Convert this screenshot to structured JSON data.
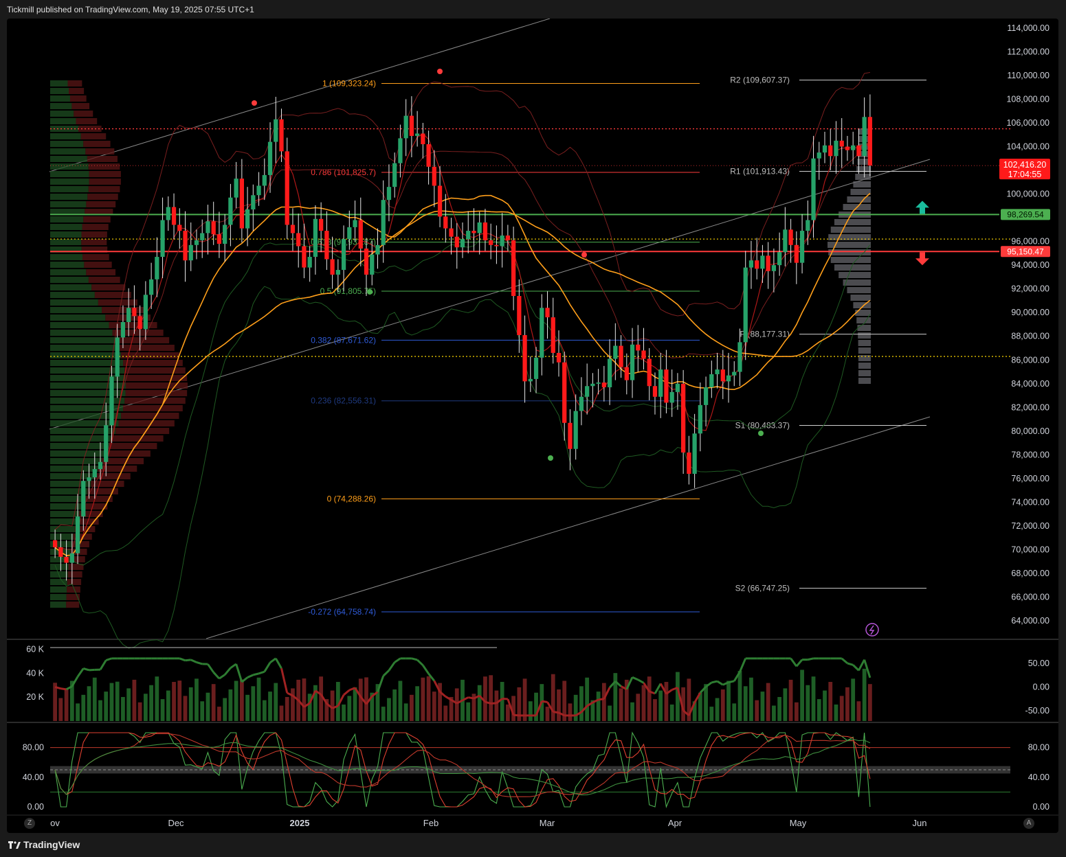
{
  "header": {
    "published": "Tickmill published on TradingView.com, May 19, 2025 07:55 UTC+1"
  },
  "footer": {
    "brand": "TradingView",
    "left_button": "Z",
    "right_button": "A"
  },
  "colors": {
    "up": "#26a269",
    "down": "#ff1a1a",
    "ma_orange": "#ff9f1a",
    "green_level": "#4caf50",
    "red_level": "#ff3b3b",
    "fib_orange": "#ff9f1a",
    "fib_blue": "#2f5bd8"
  },
  "chart_data": [
    {
      "type": "candlestick",
      "symbol_price_label": "102,416.20",
      "countdown": "17:04:55",
      "y_axis_ticks": [
        "114,000.00",
        "112,000.00",
        "110,000.00",
        "108,000.00",
        "106,000.00",
        "104,000.00",
        "100,000.00",
        "96,000.00",
        "94,000.00",
        "92,000.00",
        "90,000.00",
        "88,000.00",
        "86,000.00",
        "84,000.00",
        "82,000.00",
        "80,000.00",
        "78,000.00",
        "76,000.00",
        "74,000.00",
        "72,000.00",
        "70,000.00",
        "68,000.00",
        "66,000.00",
        "64,000.00"
      ],
      "y_axis_tick_values": [
        114000,
        112000,
        110000,
        108000,
        106000,
        104000,
        100000,
        96000,
        94000,
        92000,
        90000,
        88000,
        86000,
        84000,
        82000,
        80000,
        78000,
        76000,
        74000,
        72000,
        70000,
        68000,
        66000,
        64000
      ],
      "ylim": [
        62500,
        114800
      ],
      "x_axis_labels": [
        "ov",
        "Dec",
        "2025",
        "Feb",
        "Mar",
        "Apr",
        "May",
        "Jun"
      ],
      "price_badges": [
        {
          "label": "98,269.54",
          "value": 98269.54,
          "color": "#4caf50"
        },
        {
          "label": "95,150.47",
          "value": 95150.47,
          "color": "#ff3b3b"
        }
      ],
      "fib_levels": [
        {
          "label": "1 (109,323.24)",
          "value": 109323.24,
          "color": "#ff9f1a"
        },
        {
          "label": "0.786 (101,825.7)",
          "value": 101825.7,
          "color": "#ff3b3b"
        },
        {
          "label": "0.618 (95,937.87)",
          "value": 95937.87,
          "color": "#4caf50"
        },
        {
          "label": "0.5 (91,805.75)",
          "value": 91805.75,
          "color": "#4caf50"
        },
        {
          "label": "0.382 (87,671.62)",
          "value": 87671.62,
          "color": "#2f5bd8"
        },
        {
          "label": "0.236 (82,556.31)",
          "value": 82556.31,
          "color": "#1f3a80"
        },
        {
          "label": "0 (74,288.26)",
          "value": 74288.26,
          "color": "#ff9f1a"
        },
        {
          "label": "-0.272 (64,758.74)",
          "value": 64758.74,
          "color": "#2f5bd8"
        }
      ],
      "pivots": [
        {
          "label": "R2 (109,607.37)",
          "value": 109607.37
        },
        {
          "label": "R1 (101,913.43)",
          "value": 101913.43
        },
        {
          "label": "P (88,177.31)",
          "value": 88177.31
        },
        {
          "label": "S1 (80,483.37)",
          "value": 80483.37
        },
        {
          "label": "S2 (66,747.25)",
          "value": 66747.25
        }
      ],
      "dotted_levels": [
        105500,
        96200,
        86300
      ],
      "series_close": [
        70200,
        69400,
        68900,
        69700,
        72800,
        75800,
        76100,
        76800,
        77400,
        80500,
        84600,
        87900,
        89200,
        90400,
        89700,
        88600,
        91500,
        92800,
        94700,
        97800,
        98900,
        97400,
        96900,
        94400,
        95700,
        96100,
        96700,
        97700,
        96600,
        95800,
        97400,
        99700,
        101300,
        97100,
        98700,
        99900,
        100700,
        101600,
        104400,
        106300,
        103600,
        97400,
        96700,
        95600,
        93800,
        94700,
        97900,
        96900,
        94500,
        93200,
        93600,
        96200,
        97200,
        97800,
        95400,
        93200,
        94900,
        95700,
        99500,
        100600,
        102600,
        104700,
        106600,
        104900,
        105100,
        104200,
        102300,
        100700,
        98100,
        97100,
        96400,
        95500,
        96200,
        96900,
        96700,
        97600,
        96100,
        95700,
        95600,
        96500,
        96100,
        91400,
        88100,
        84200,
        84400,
        86200,
        90400,
        89600,
        86600,
        85800,
        80700,
        78500,
        81700,
        82900,
        83800,
        84000,
        84100,
        83700,
        86100,
        87200,
        85400,
        84300,
        87300,
        86800,
        86100,
        83800,
        82900,
        85200,
        82400,
        83300,
        84000,
        78200,
        76400,
        79800,
        82200,
        83700,
        84800,
        85200,
        84200,
        84700,
        85000,
        87500,
        93800,
        94400,
        93700,
        94800,
        93500,
        94000,
        95100,
        97000,
        95700,
        94200,
        96900,
        97800,
        103000,
        103500,
        104100,
        103200,
        104500,
        104000,
        103700,
        104100,
        103200,
        106500,
        102400
      ],
      "series_open": [
        70800,
        70200,
        69400,
        68900,
        69700,
        72800,
        75800,
        76100,
        76800,
        77400,
        80500,
        84600,
        87900,
        89200,
        90400,
        89700,
        88600,
        91500,
        92800,
        94700,
        97800,
        98900,
        97400,
        96900,
        94400,
        95700,
        96100,
        96700,
        97700,
        96600,
        95800,
        97400,
        99700,
        101300,
        97100,
        98700,
        99900,
        100700,
        101600,
        104400,
        106300,
        103600,
        97400,
        96700,
        95600,
        93800,
        94700,
        97900,
        96900,
        94500,
        93200,
        93600,
        96200,
        97200,
        97800,
        95400,
        93200,
        94900,
        95700,
        99500,
        100600,
        102600,
        104700,
        106600,
        104900,
        105100,
        104200,
        102300,
        100700,
        98100,
        97100,
        96400,
        95500,
        96200,
        96900,
        96700,
        97600,
        96100,
        95700,
        95600,
        96500,
        96100,
        91400,
        88100,
        84200,
        84400,
        86200,
        90400,
        89600,
        86600,
        85800,
        80700,
        78500,
        81700,
        82900,
        83800,
        84000,
        84100,
        83700,
        86100,
        87200,
        85400,
        84300,
        87300,
        86800,
        86100,
        83800,
        82900,
        85200,
        82400,
        83300,
        84000,
        78200,
        76400,
        79800,
        82200,
        83700,
        84800,
        85200,
        84200,
        84700,
        85000,
        87500,
        93800,
        94400,
        93700,
        94800,
        93500,
        94000,
        95100,
        97000,
        95700,
        94200,
        96900,
        97800,
        103000,
        103500,
        104100,
        103200,
        104500,
        104000,
        103700,
        104100,
        103200,
        106500
      ]
    },
    {
      "type": "bar+line",
      "name": "volume-oscillator",
      "left_ticks": [
        "60 K",
        "40 K",
        "20 K"
      ],
      "left_tick_values": [
        60000,
        40000,
        20000
      ],
      "right_ticks": [
        "50.00",
        "0.00",
        "-50.00"
      ],
      "right_tick_values": [
        50,
        0,
        -50
      ]
    },
    {
      "type": "line",
      "name": "stochastic-rsi",
      "left_ticks": [
        "80.00",
        "40.00",
        "0.00"
      ],
      "right_ticks": [
        "80.00",
        "40.00",
        "0.00"
      ],
      "tick_values": [
        80,
        40,
        0
      ],
      "bands": [
        80,
        20
      ]
    }
  ]
}
